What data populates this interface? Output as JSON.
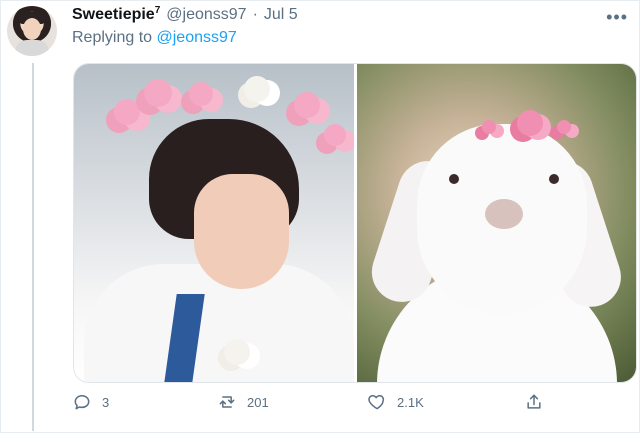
{
  "tweet": {
    "display_name": "Sweetiepie",
    "display_name_suffix": "7",
    "handle": "@jeonss97",
    "dot": "·",
    "date": "Jul 5",
    "more": "•••",
    "replying_label": "Replying to",
    "replying_to": "@jeonss97"
  },
  "actions": {
    "replies": "3",
    "retweets": "201",
    "likes": "2.1K"
  },
  "colors": {
    "accent": "#1da1f2",
    "muted": "#5b7083",
    "thread_line": "#cfd9de"
  },
  "icons": {
    "reply": "reply-icon",
    "retweet": "retweet-icon",
    "like": "heart-icon",
    "share": "share-icon",
    "more": "more-icon"
  }
}
